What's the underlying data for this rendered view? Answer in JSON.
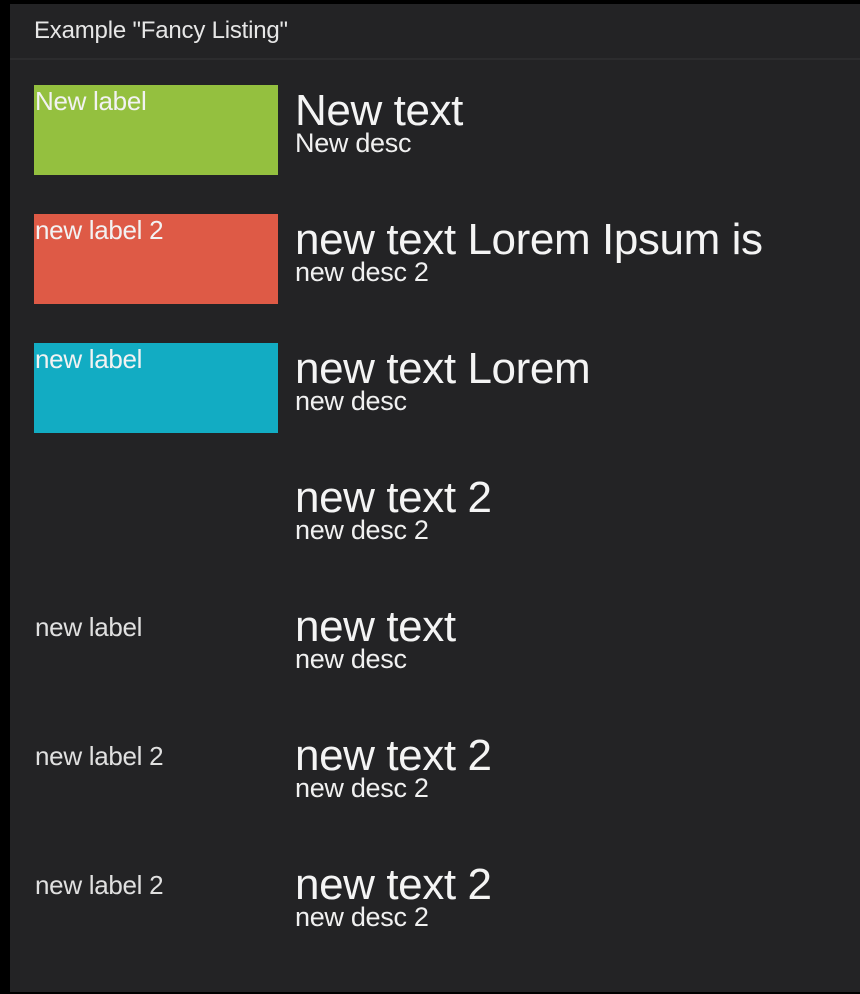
{
  "panel": {
    "title": "Example \"Fancy Listing\""
  },
  "items": [
    {
      "label": "New label",
      "label_color": "#94c03f",
      "text": "New text",
      "desc": "New desc"
    },
    {
      "label": "new label 2",
      "label_color": "#de5a46",
      "text": "new text Lorem Ipsum is",
      "desc": "new desc 2"
    },
    {
      "label": "new label",
      "label_color": "#12acc3",
      "text": "new text Lorem",
      "desc": "new desc"
    },
    {
      "label": "",
      "label_color": "",
      "text": "new text 2",
      "desc": "new desc 2"
    },
    {
      "label": "new label",
      "label_color": "",
      "text": "new text",
      "desc": "new desc"
    },
    {
      "label": "new label 2",
      "label_color": "",
      "text": "new text 2",
      "desc": "new desc 2"
    },
    {
      "label": "new label 2",
      "label_color": "",
      "text": "new text 2",
      "desc": "new desc 2"
    }
  ]
}
